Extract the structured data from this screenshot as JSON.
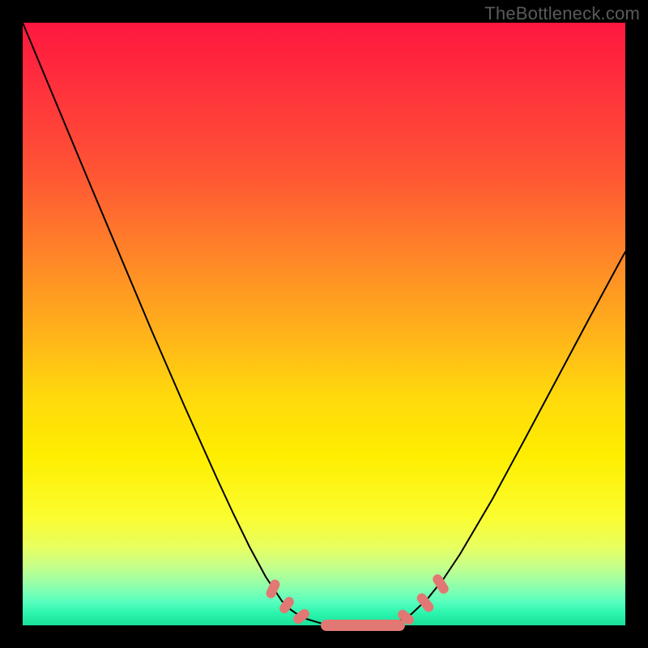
{
  "watermark": "TheBottleneck.com",
  "colors": {
    "frame": "#000000",
    "gradient_top": "#ff173f",
    "gradient_bottom": "#1ae09a",
    "curve": "#000000",
    "pill": "#e27873",
    "watermark": "#5a5a5a"
  },
  "chart_data": {
    "type": "line",
    "title": "",
    "xlabel": "",
    "ylabel": "",
    "xlim": [
      0,
      1
    ],
    "ylim": [
      0,
      1
    ],
    "legend": false,
    "grid": false,
    "annotations": [
      "TheBottleneck.com"
    ],
    "notes": "V-shaped bottleneck curve over vertical color field (red=high bottleneck, green=low). No numeric axes shown; values estimated from pixel geometry mapped to [0,1]×[0,1].",
    "series": [
      {
        "name": "left-branch",
        "x": [
          0.0,
          0.054,
          0.108,
          0.161,
          0.215,
          0.269,
          0.323,
          0.349,
          0.376,
          0.403,
          0.43,
          0.444,
          0.457,
          0.47,
          0.497,
          0.524
        ],
        "y": [
          1.0,
          0.871,
          0.742,
          0.614,
          0.487,
          0.363,
          0.243,
          0.186,
          0.131,
          0.081,
          0.04,
          0.027,
          0.017,
          0.011,
          0.003,
          0.0
        ]
      },
      {
        "name": "valley-floor",
        "x": [
          0.524,
          0.538,
          0.551,
          0.565,
          0.578,
          0.591,
          0.605,
          0.618
        ],
        "y": [
          0.0,
          0.0,
          0.0,
          0.001,
          0.001,
          0.002,
          0.003,
          0.004
        ]
      },
      {
        "name": "right-branch",
        "x": [
          0.618,
          0.632,
          0.645,
          0.672,
          0.699,
          0.726,
          0.78,
          0.833,
          0.887,
          0.941,
          0.995,
          1.0
        ],
        "y": [
          0.004,
          0.011,
          0.019,
          0.044,
          0.078,
          0.118,
          0.21,
          0.309,
          0.41,
          0.511,
          0.61,
          0.62
        ]
      }
    ],
    "pill_markers": [
      {
        "group": "left-descent",
        "x": 0.415,
        "y": 0.06,
        "angle_deg": -66
      },
      {
        "group": "left-descent",
        "x": 0.438,
        "y": 0.033,
        "angle_deg": -55
      },
      {
        "group": "left-descent",
        "x": 0.462,
        "y": 0.015,
        "angle_deg": -38
      },
      {
        "group": "valley-bar",
        "x": 0.565,
        "y": 0.0,
        "angle_deg": 0
      },
      {
        "group": "right-ascent",
        "x": 0.636,
        "y": 0.014,
        "angle_deg": 40
      },
      {
        "group": "right-ascent",
        "x": 0.668,
        "y": 0.037,
        "angle_deg": 52
      },
      {
        "group": "right-ascent",
        "x": 0.694,
        "y": 0.069,
        "angle_deg": 58
      }
    ]
  }
}
